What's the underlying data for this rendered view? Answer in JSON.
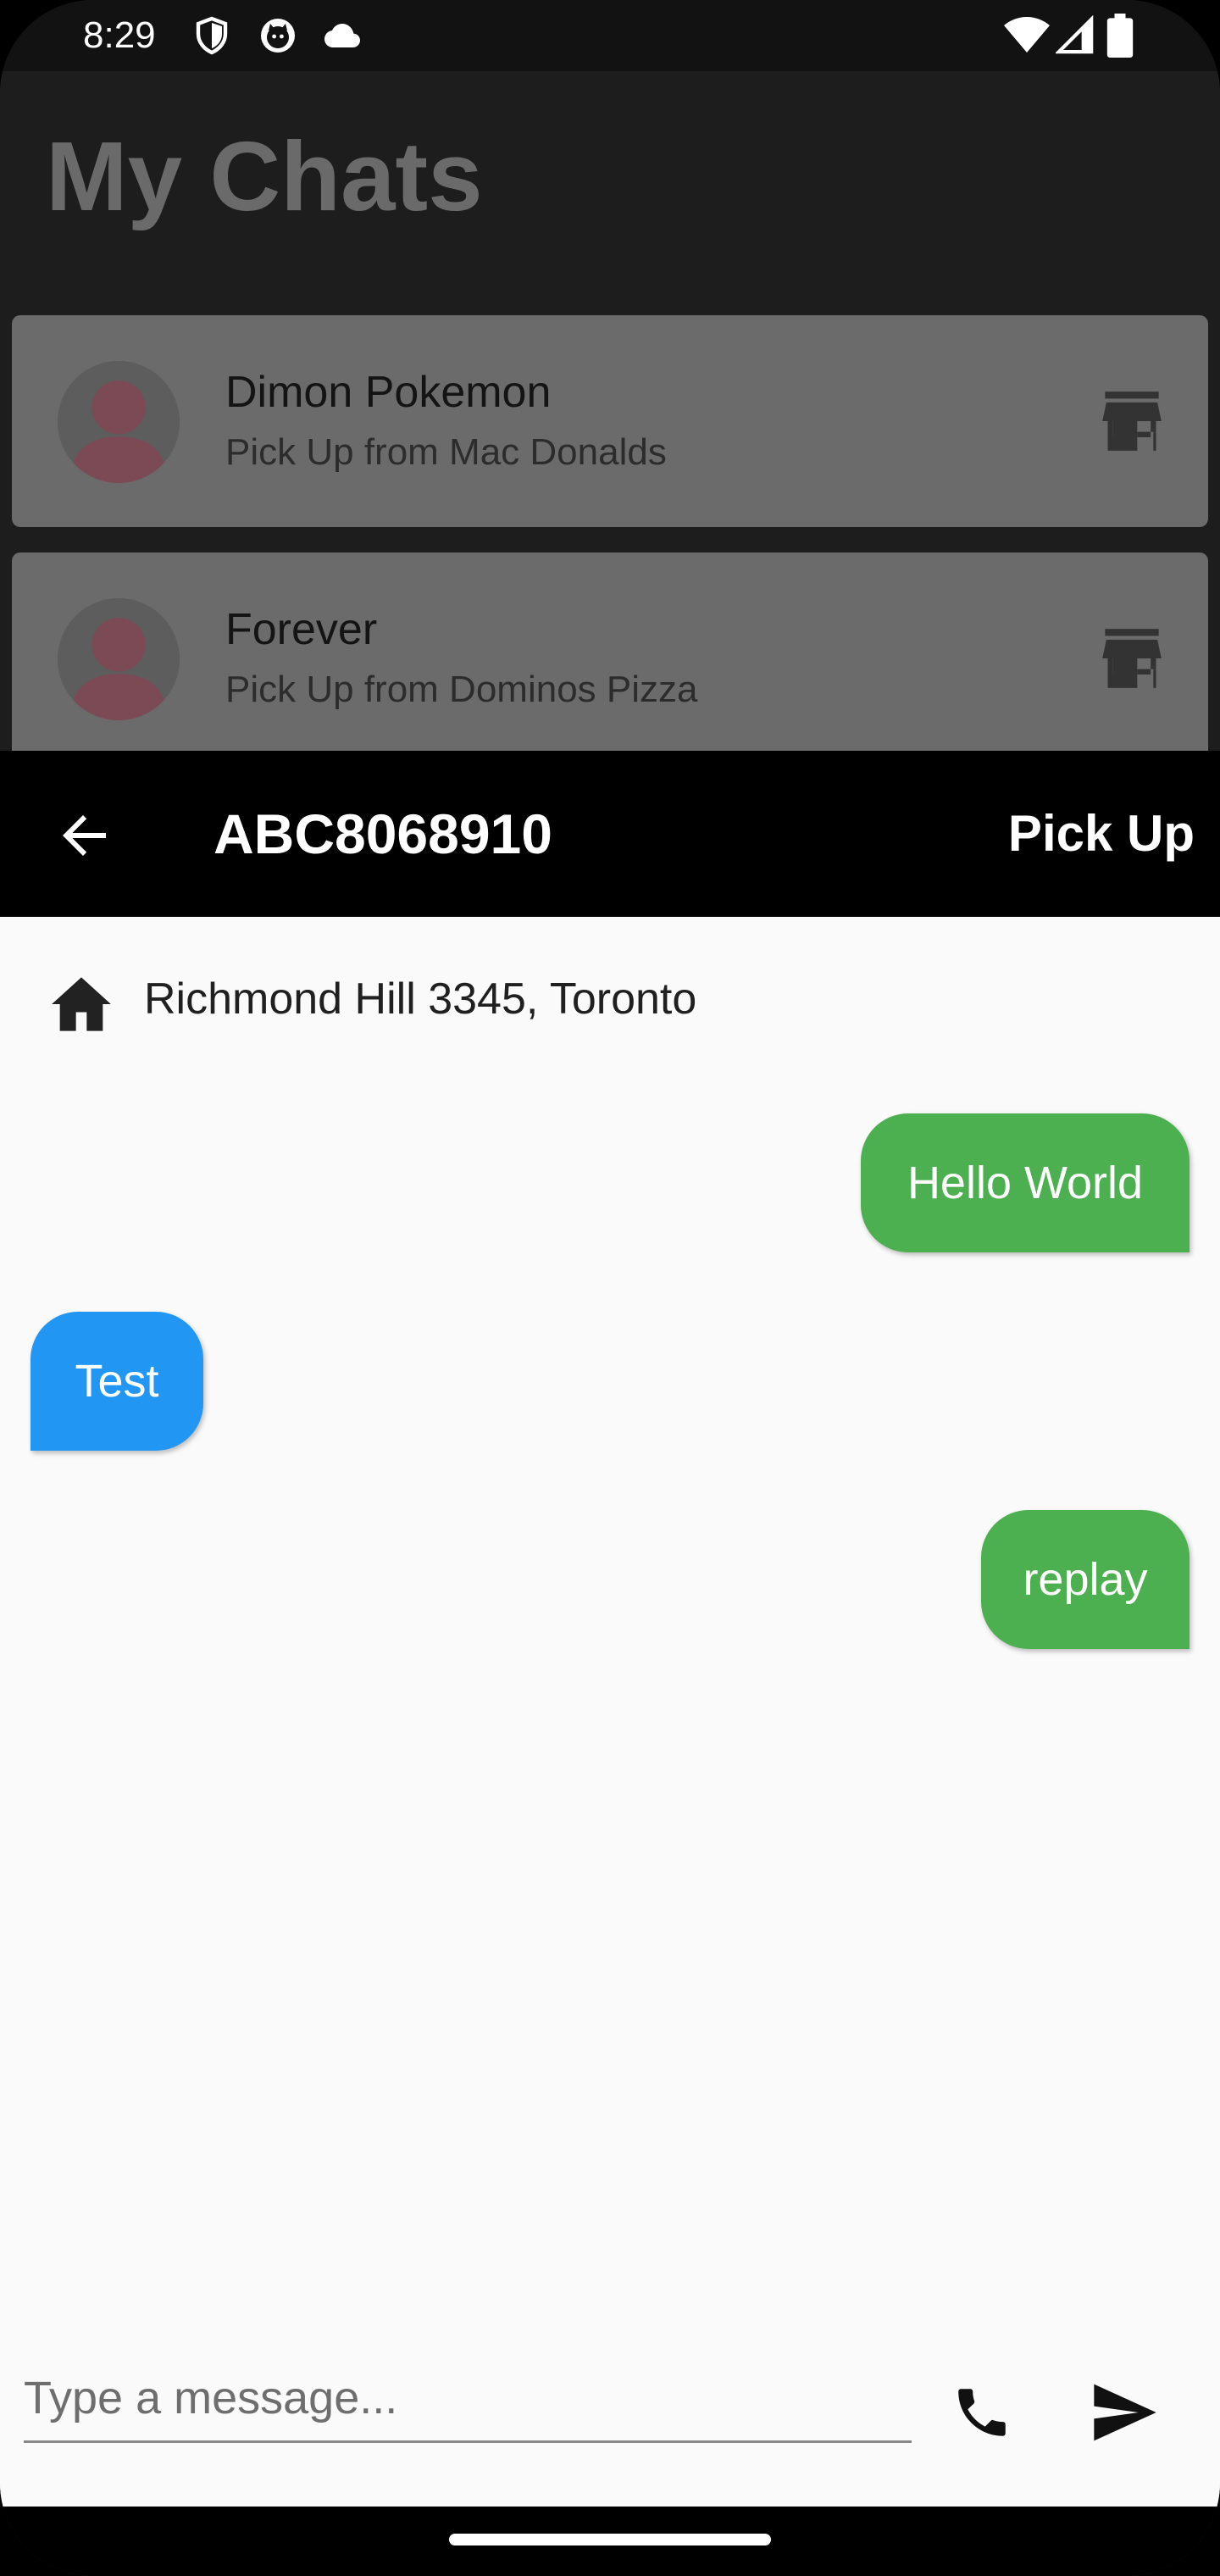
{
  "status_bar": {
    "time": "8:29",
    "left_icons": [
      "shield-icon",
      "cat-notification-icon",
      "cloud-icon"
    ],
    "right_icons": [
      "wifi-icon",
      "signal-icon",
      "battery-icon"
    ]
  },
  "chat_list": {
    "title": "My Chats",
    "items": [
      {
        "name": "Dimon Pokemon",
        "subtitle": "Pick Up from Mac Donalds",
        "icon": "store-icon"
      },
      {
        "name": "Forever",
        "subtitle": "Pick Up from Dominos Pizza",
        "icon": "store-icon"
      }
    ]
  },
  "chat": {
    "order_id": "ABC8068910",
    "action_label": "Pick Up",
    "address": "Richmond Hill 3345, Toronto",
    "messages": [
      {
        "text": "Hello World",
        "direction": "outgoing"
      },
      {
        "text": "Test",
        "direction": "incoming"
      },
      {
        "text": "replay",
        "direction": "outgoing"
      }
    ]
  },
  "composer": {
    "placeholder": "Type a message...",
    "value": ""
  },
  "colors": {
    "outgoing_bubble": "#4caf50",
    "incoming_bubble": "#2196f3",
    "app_bar": "#000000",
    "chat_background": "#fafafa"
  }
}
